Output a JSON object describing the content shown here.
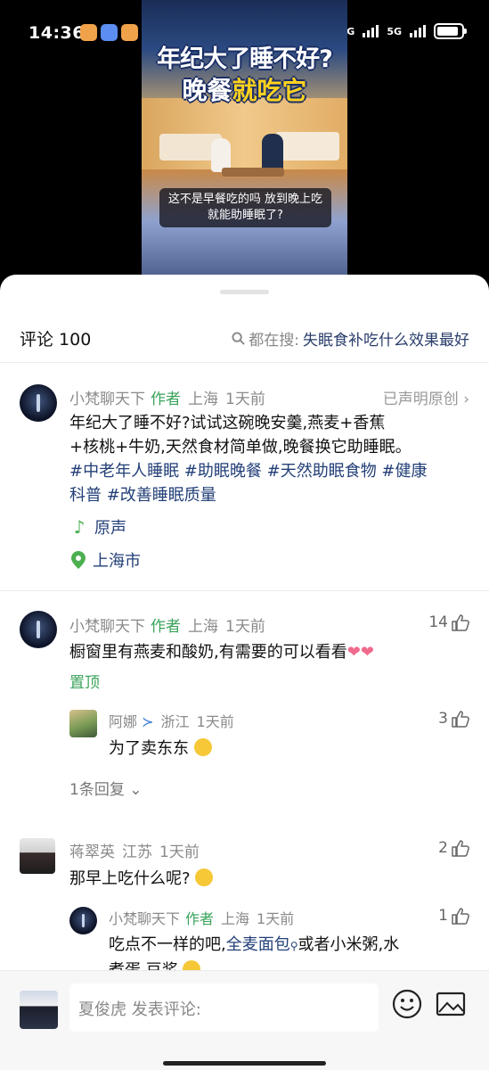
{
  "status_bar": {
    "time": "14:36",
    "net1": "5G",
    "net2": "5G",
    "battery_level": 0.9
  },
  "video": {
    "title_line1": "年纪大了睡不好?",
    "title_line2_a": "晚餐",
    "title_line2_b": "就吃它",
    "caption": "这不是早餐吃的吗 放到晚上吃就能助睡眠了?"
  },
  "header": {
    "comments_label": "评论 100",
    "search_prefix": "都在搜:",
    "search_term": "失眠食补吃什么效果最好"
  },
  "post": {
    "author": "小梵聊天下",
    "author_tag": "作者",
    "location": "上海",
    "time": "1天前",
    "original": "已声明原创 ›",
    "text_line1": "年纪大了睡不好?试试这碗晚安羹,燕麦+香蕉",
    "text_line2": "+核桃+牛奶,天然食材简单做,晚餐换它助睡眠。",
    "tags_line3": "#中老年人睡眠 #助眠晚餐 #天然助眠食物 #健康",
    "tags_line4": "科普 #改善睡眠质量",
    "sound": "原声",
    "place": "上海市"
  },
  "comments": [
    {
      "author": "小梵聊天下",
      "author_tag": "作者",
      "location": "上海",
      "time": "1天前",
      "likes": "14",
      "text": "橱窗里有燕麦和酸奶,有需要的可以看看",
      "pinned": "置顶",
      "reply": {
        "author": "阿娜",
        "location": "浙江",
        "time": "1天前",
        "likes": "3",
        "text": "为了卖东东"
      },
      "expand": "1条回复"
    },
    {
      "author": "蒋翠英",
      "location": "江苏",
      "time": "1天前",
      "likes": "2",
      "text": "那早上吃什么呢?",
      "reply": {
        "author": "小梵聊天下",
        "author_tag": "作者",
        "location": "上海",
        "time": "1天前",
        "likes": "1",
        "text_a": "吃点不一样的吧,",
        "link": "全麦面包",
        "text_b": "或者小米粥,水",
        "text_line2": "煮蛋,豆浆"
      }
    }
  ],
  "composer": {
    "placeholder": "夏俊虎 发表评论:"
  }
}
